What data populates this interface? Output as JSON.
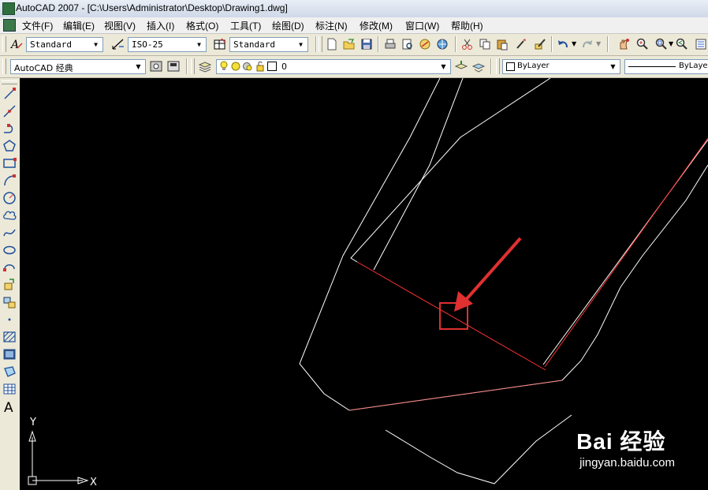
{
  "window": {
    "title": "AutoCAD 2007 - [C:\\Users\\Administrator\\Desktop\\Drawing1.dwg]"
  },
  "menu": [
    {
      "label": "文件(F)"
    },
    {
      "label": "编辑(E)"
    },
    {
      "label": "视图(V)"
    },
    {
      "label": "插入(I)"
    },
    {
      "label": "格式(O)"
    },
    {
      "label": "工具(T)"
    },
    {
      "label": "绘图(D)"
    },
    {
      "label": "标注(N)"
    },
    {
      "label": "修改(M)"
    },
    {
      "label": "窗口(W)"
    },
    {
      "label": "帮助(H)"
    }
  ],
  "styles_toolbar": {
    "text_style": "Standard",
    "dim_style": "ISO-25",
    "table_style": "Standard"
  },
  "workspace": "AutoCAD 经典",
  "layer": "0",
  "properties": {
    "color": "ByLayer",
    "linetype": "ByLayer"
  },
  "ucs": {
    "y_label": "Y",
    "x_label": "X"
  },
  "watermark": {
    "brand": "Bai 经验",
    "url": "jingyan.baidu.com"
  },
  "colors": {
    "canvas": "#000000",
    "line": "#ffffff",
    "highlight": "#ff3333",
    "annotation": "#e03030"
  }
}
